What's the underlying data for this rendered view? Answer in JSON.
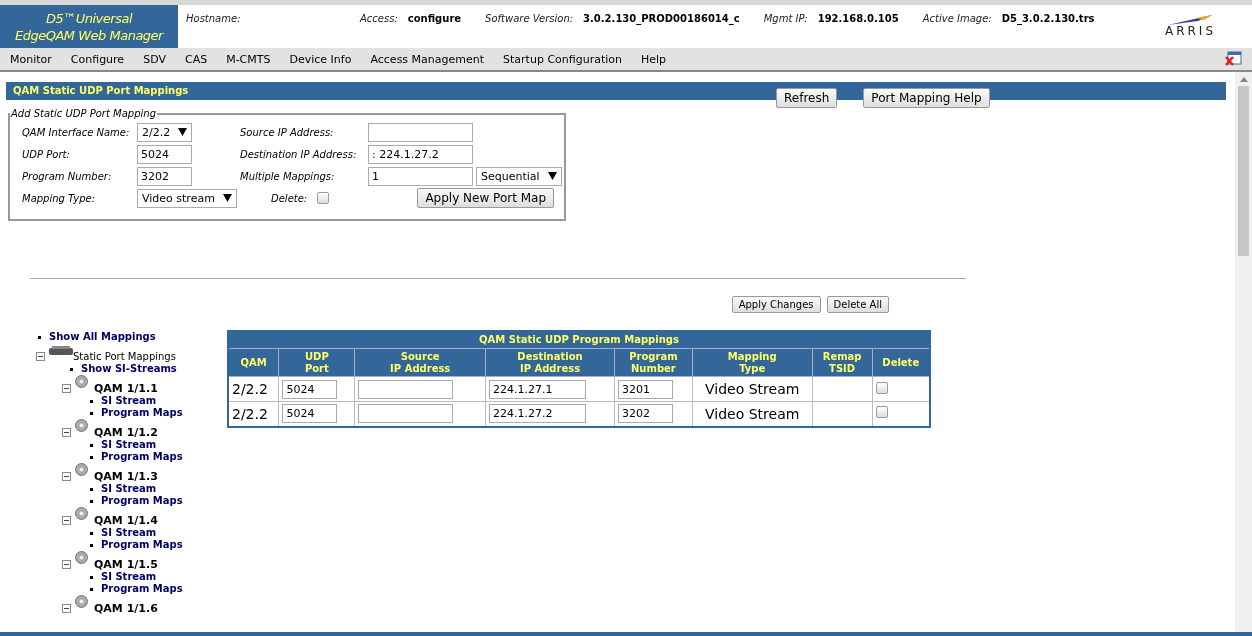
{
  "header": {
    "logo_lines": [
      "D5™Universal",
      "EdgeQAM Web Manager"
    ],
    "fields": [
      {
        "label": "Hostname:"
      },
      {
        "label": "Access:",
        "value": "configure"
      },
      {
        "label": "Software Version:",
        "value": "3.0.2.130_PROD00186014_c"
      },
      {
        "label": "Mgmt IP:",
        "value": "192.168.0.105"
      },
      {
        "label": "Active Image:",
        "value": "D5_3.0.2.130.trs"
      }
    ],
    "brand": "ARRIS"
  },
  "menu": [
    "Monitor",
    "Configure",
    "SDV",
    "CAS",
    "M-CMTS",
    "Device Info",
    "Access Management",
    "Startup Configuration",
    "Help"
  ],
  "page": {
    "title": "QAM Static UDP Port Mappings",
    "buttons": [
      "Refresh",
      "Port Mapping Help"
    ]
  },
  "form": {
    "legend": "Add Static UDP Port Mapping",
    "rows": [
      [
        {
          "kind": "label",
          "text": "QAM Interface Name:"
        },
        {
          "kind": "select",
          "value": "2/2.2"
        },
        {
          "kind": "label",
          "text": "Source IP Address:"
        },
        {
          "kind": "input"
        }
      ],
      [
        {
          "kind": "label",
          "text": "UDP Port:"
        },
        {
          "kind": "input",
          "value": "5024"
        },
        {
          "kind": "label",
          "text": "Destination IP Address:"
        },
        {
          "kind": "input",
          "value": ": 224.1.27.2"
        }
      ],
      [
        {
          "kind": "label",
          "text": "Program Number:"
        },
        {
          "kind": "input",
          "value": "3202"
        },
        {
          "kind": "label",
          "text": "Multiple Mappings:"
        },
        {
          "kind": "input",
          "value": "1"
        },
        {
          "kind": "select",
          "value": "Sequential"
        }
      ],
      [
        {
          "kind": "label",
          "text": "Mapping Type:"
        },
        {
          "kind": "select",
          "value": "Video stream"
        },
        {
          "kind": "checkbox",
          "text": "Delete:",
          "checked": false
        },
        {
          "kind": "button",
          "text": "Apply New Port Map"
        }
      ]
    ]
  },
  "actions": [
    "Apply Changes",
    "Delete All"
  ],
  "tree": [
    {
      "kind": "link",
      "label": "Show All Mappings"
    },
    {
      "kind": "device",
      "label": "Static Port Mappings",
      "expanded": true,
      "children": [
        {
          "kind": "link",
          "label": "Show SI-Streams"
        },
        {
          "kind": "channel",
          "label": "QAM 1/1.1",
          "expanded": true,
          "children": [
            {
              "kind": "link",
              "label": "SI Stream"
            },
            {
              "kind": "link",
              "label": "Program Maps"
            }
          ]
        },
        {
          "kind": "channel",
          "label": "QAM 1/1.2",
          "expanded": true,
          "children": [
            {
              "kind": "link",
              "label": "SI Stream"
            },
            {
              "kind": "link",
              "label": "Program Maps"
            }
          ]
        },
        {
          "kind": "channel",
          "label": "QAM 1/1.3",
          "expanded": true,
          "children": [
            {
              "kind": "link",
              "label": "SI Stream"
            },
            {
              "kind": "link",
              "label": "Program Maps"
            }
          ]
        },
        {
          "kind": "channel",
          "label": "QAM 1/1.4",
          "expanded": true,
          "children": [
            {
              "kind": "link",
              "label": "SI Stream"
            },
            {
              "kind": "link",
              "label": "Program Maps"
            }
          ]
        },
        {
          "kind": "channel",
          "label": "QAM 1/1.5",
          "expanded": true,
          "children": [
            {
              "kind": "link",
              "label": "SI Stream"
            },
            {
              "kind": "link",
              "label": "Program Maps"
            }
          ]
        },
        {
          "kind": "channel",
          "label": "QAM 1/1.6",
          "expanded": true
        }
      ]
    }
  ],
  "table": {
    "title": "QAM Static UDP Program Mappings",
    "columns": [
      "QAM",
      "UDP\nPort",
      "Source\nIP Address",
      "Destination\nIP Address",
      "Program\nNumber",
      "Mapping\nType",
      "Remap\nTSID",
      "Delete"
    ],
    "rows": [
      {
        "qam": "2/2.2",
        "udp_port": "5024",
        "destination_ip": "224.1.27.1",
        "program_number": "3201",
        "mapping_type": "Video Stream",
        "delete": false
      },
      {
        "qam": "2/2.2",
        "udp_port": "5024",
        "destination_ip": "224.1.27.2",
        "program_number": "3202",
        "mapping_type": "Video Stream",
        "delete": false
      }
    ]
  }
}
